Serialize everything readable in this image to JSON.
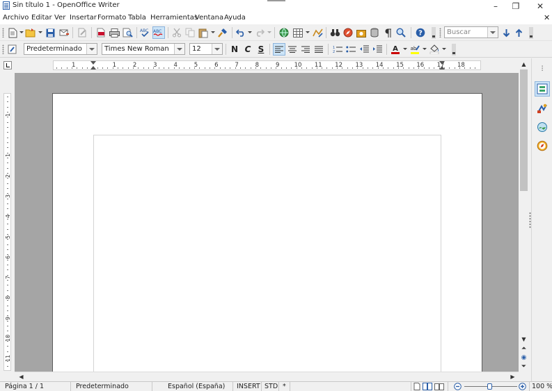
{
  "window": {
    "title": "Sin título 1 - OpenOffice Writer",
    "minimize_glyph": "–",
    "restore_glyph": "❐",
    "close_glyph": "✕"
  },
  "menu": {
    "items": [
      "Archivo",
      "Editar",
      "Ver",
      "Insertar",
      "Formato",
      "Tabla",
      "Herramientas",
      "Ventana",
      "Ayuda"
    ],
    "close_doc_glyph": "✕"
  },
  "toolbar_standard": {
    "icons": [
      "new-document-icon",
      "open-folder-icon",
      "save-icon",
      "email-icon",
      "edit-file-icon",
      "export-pdf-icon",
      "print-icon",
      "print-preview-icon",
      "spellcheck-icon",
      "autospellcheck-icon",
      "cut-icon",
      "copy-icon",
      "paste-icon",
      "format-paintbrush-icon",
      "undo-icon",
      "redo-icon",
      "hyperlink-icon",
      "table-icon",
      "draw-functions-icon",
      "find-replace-icon",
      "navigator-icon",
      "gallery-icon",
      "data-sources-icon",
      "nonprinting-chars-icon",
      "zoom-icon",
      "help-icon"
    ],
    "search_placeholder": "Buscar"
  },
  "toolbar_format": {
    "paragraph_style": "Predeterminado",
    "font_name": "Times New Roman",
    "font_size": "12",
    "bold_label": "N",
    "italic_label": "C",
    "underline_label": "S",
    "font_color": "#cc0000",
    "highlight_color": "#ffff00",
    "background_color": "#ffffff"
  },
  "ruler": {
    "numbers": [
      "1",
      "1",
      "2",
      "3",
      "4",
      "5",
      "6",
      "7",
      "8",
      "9",
      "10",
      "11",
      "12",
      "13",
      "14",
      "15",
      "16",
      "17",
      "18"
    ],
    "vertical_numbers": [
      "1",
      "1",
      "2",
      "3",
      "4",
      "5",
      "6",
      "7",
      "8",
      "9",
      "10",
      "11"
    ]
  },
  "statusbar": {
    "page": "Página  1 / 1",
    "style": "Predeterminado",
    "language": "Español (España)",
    "insert_mode": "INSERT",
    "selection_mode": "STD",
    "modified": "*",
    "zoom": "100 %"
  },
  "colors": {
    "accent": "#2a5ea8",
    "document_background": "#a5a5a5",
    "page": "#ffffff"
  }
}
